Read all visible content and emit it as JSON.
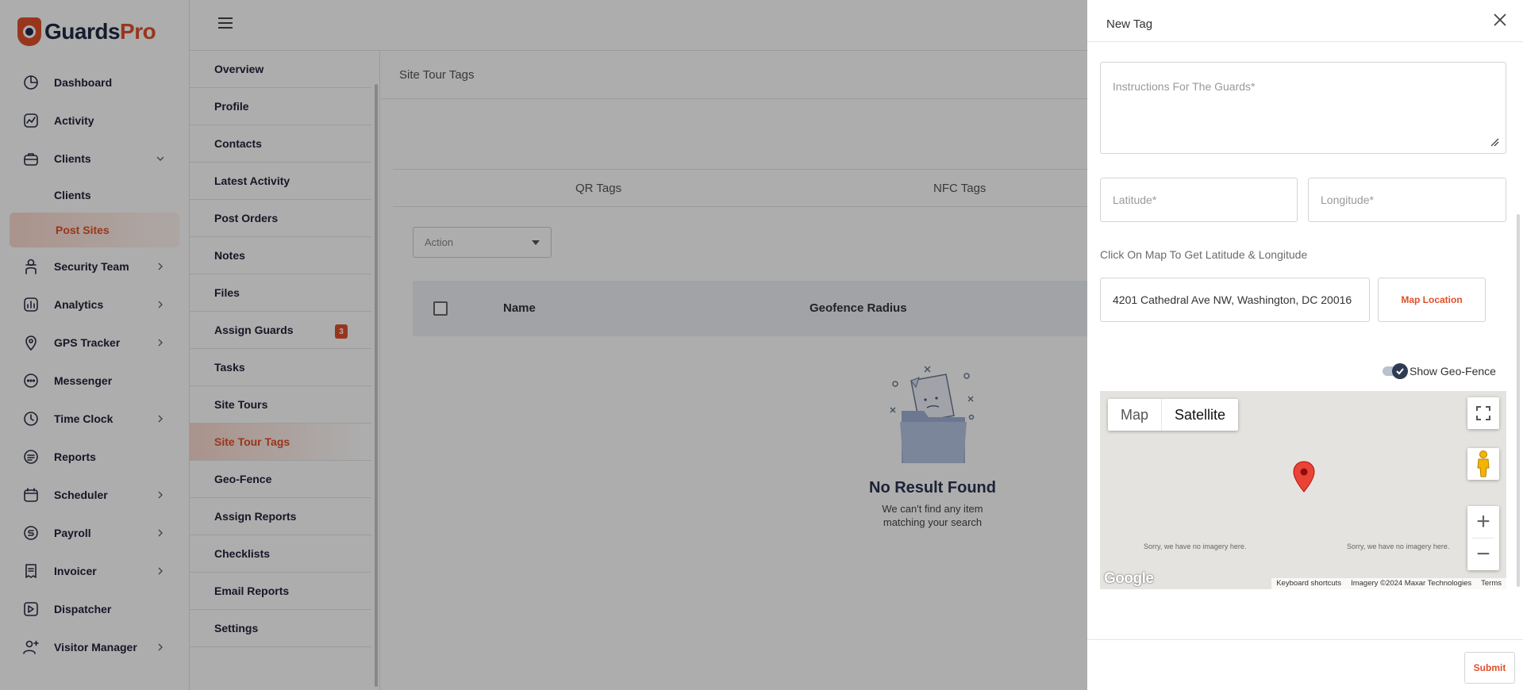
{
  "brand": {
    "part1": "Guards",
    "part2": "Pro",
    "accent": "#e0502b",
    "dark": "#1f2a44"
  },
  "sidebar": {
    "items": [
      {
        "label": "Dashboard",
        "icon": "dashboard-icon"
      },
      {
        "label": "Activity",
        "icon": "activity-icon"
      },
      {
        "label": "Clients",
        "icon": "clients-icon",
        "expanded": true
      },
      {
        "label": "Security Team",
        "icon": "security-team-icon"
      },
      {
        "label": "Analytics",
        "icon": "analytics-icon"
      },
      {
        "label": "GPS Tracker",
        "icon": "gps-icon"
      },
      {
        "label": "Messenger",
        "icon": "messenger-icon"
      },
      {
        "label": "Time Clock",
        "icon": "clock-icon"
      },
      {
        "label": "Reports",
        "icon": "reports-icon"
      },
      {
        "label": "Scheduler",
        "icon": "calendar-icon"
      },
      {
        "label": "Payroll",
        "icon": "payroll-icon"
      },
      {
        "label": "Invoicer",
        "icon": "invoice-icon"
      },
      {
        "label": "Dispatcher",
        "icon": "dispatcher-icon"
      },
      {
        "label": "Visitor Manager",
        "icon": "visitor-icon"
      }
    ],
    "clients_sub": [
      {
        "label": "Clients"
      },
      {
        "label": "Post Sites",
        "active": true
      }
    ]
  },
  "submenu": {
    "items": [
      {
        "label": "Overview"
      },
      {
        "label": "Profile"
      },
      {
        "label": "Contacts"
      },
      {
        "label": "Latest Activity"
      },
      {
        "label": "Post Orders"
      },
      {
        "label": "Notes"
      },
      {
        "label": "Files"
      },
      {
        "label": "Assign Guards",
        "badge": "3"
      },
      {
        "label": "Tasks"
      },
      {
        "label": "Site Tours"
      },
      {
        "label": "Site Tour Tags",
        "active": true
      },
      {
        "label": "Geo-Fence"
      },
      {
        "label": "Assign Reports"
      },
      {
        "label": "Checklists"
      },
      {
        "label": "Email Reports"
      },
      {
        "label": "Settings"
      }
    ]
  },
  "main": {
    "title": "Site Tour Tags",
    "tabs": [
      "QR Tags",
      "NFC Tags"
    ],
    "action_placeholder": "Action",
    "columns": [
      "Name",
      "Geofence Radius"
    ],
    "empty_title": "No Result Found",
    "empty_line1": "We can't find any item",
    "empty_line2": "matching your search"
  },
  "drawer": {
    "title": "New Tag",
    "instructions_placeholder": "Instructions For The Guards*",
    "latitude_placeholder": "Latitude*",
    "longitude_placeholder": "Longitude*",
    "hint": "Click On Map To Get Latitude & Longitude",
    "address_value": "4201 Cathedral Ave NW, Washington, DC 20016",
    "map_location_label": "Map Location",
    "geofence_label": "Show Geo-Fence",
    "geofence_on": true,
    "submit_label": "Submit",
    "map": {
      "type_map": "Map",
      "type_satellite": "Satellite",
      "selected_type": "Satellite",
      "no_imagery": "Sorry, we have no imagery here.",
      "google": "Google",
      "keyboard": "Keyboard shortcuts",
      "imagery": "Imagery ©2024 Maxar Technologies",
      "terms": "Terms"
    }
  }
}
